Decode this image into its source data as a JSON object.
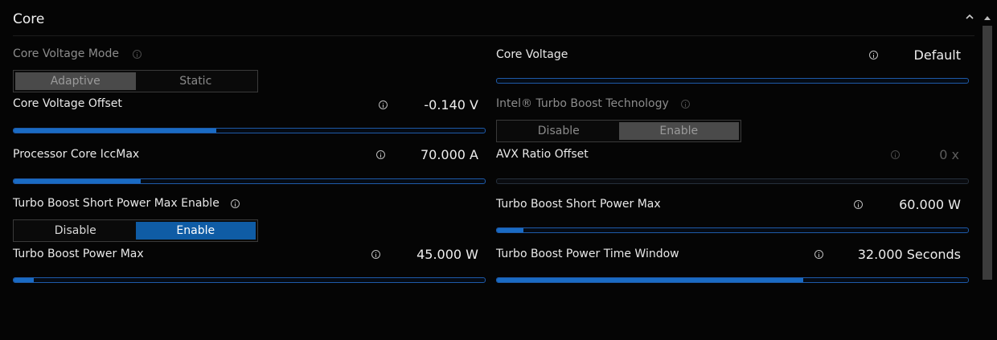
{
  "section": {
    "title": "Core"
  },
  "colors": {
    "accent": "#1a6bc4",
    "background": "#050505",
    "selected_toggle": "#0f5ca5"
  },
  "core_voltage_mode": {
    "label": "Core Voltage Mode",
    "options": [
      "Adaptive",
      "Static"
    ],
    "selected": "Adaptive",
    "disabled": true
  },
  "core_voltage": {
    "label": "Core Voltage",
    "value": "Default",
    "level": 0
  },
  "core_voltage_offset": {
    "label": "Core Voltage Offset",
    "value": "-0.140 V",
    "level": 0.43
  },
  "turbo_boost_technology": {
    "label": "Intel® Turbo Boost Technology",
    "options": [
      "Disable",
      "Enable"
    ],
    "selected": "Enable",
    "disabled": true
  },
  "processor_core_iccmax": {
    "label": "Processor Core IccMax",
    "value": "70.000 A",
    "level": 0.27
  },
  "avx_ratio_offset": {
    "label": "AVX Ratio Offset",
    "value": "0 x",
    "level": 0,
    "disabled": true
  },
  "short_power_max_enable": {
    "label": "Turbo Boost Short Power Max Enable",
    "options": [
      "Disable",
      "Enable"
    ],
    "selected": "Enable"
  },
  "short_power_max": {
    "label": "Turbo Boost Short Power Max",
    "value": "60.000 W",
    "level": 0.057
  },
  "power_max": {
    "label": "Turbo Boost Power Max",
    "value": "45.000 W",
    "level": 0.043
  },
  "power_time_window": {
    "label": "Turbo Boost Power Time Window",
    "value": "32.000 Seconds",
    "level": 0.65
  },
  "icons": {
    "info": "info-icon",
    "collapse": "chevron-up-icon"
  }
}
